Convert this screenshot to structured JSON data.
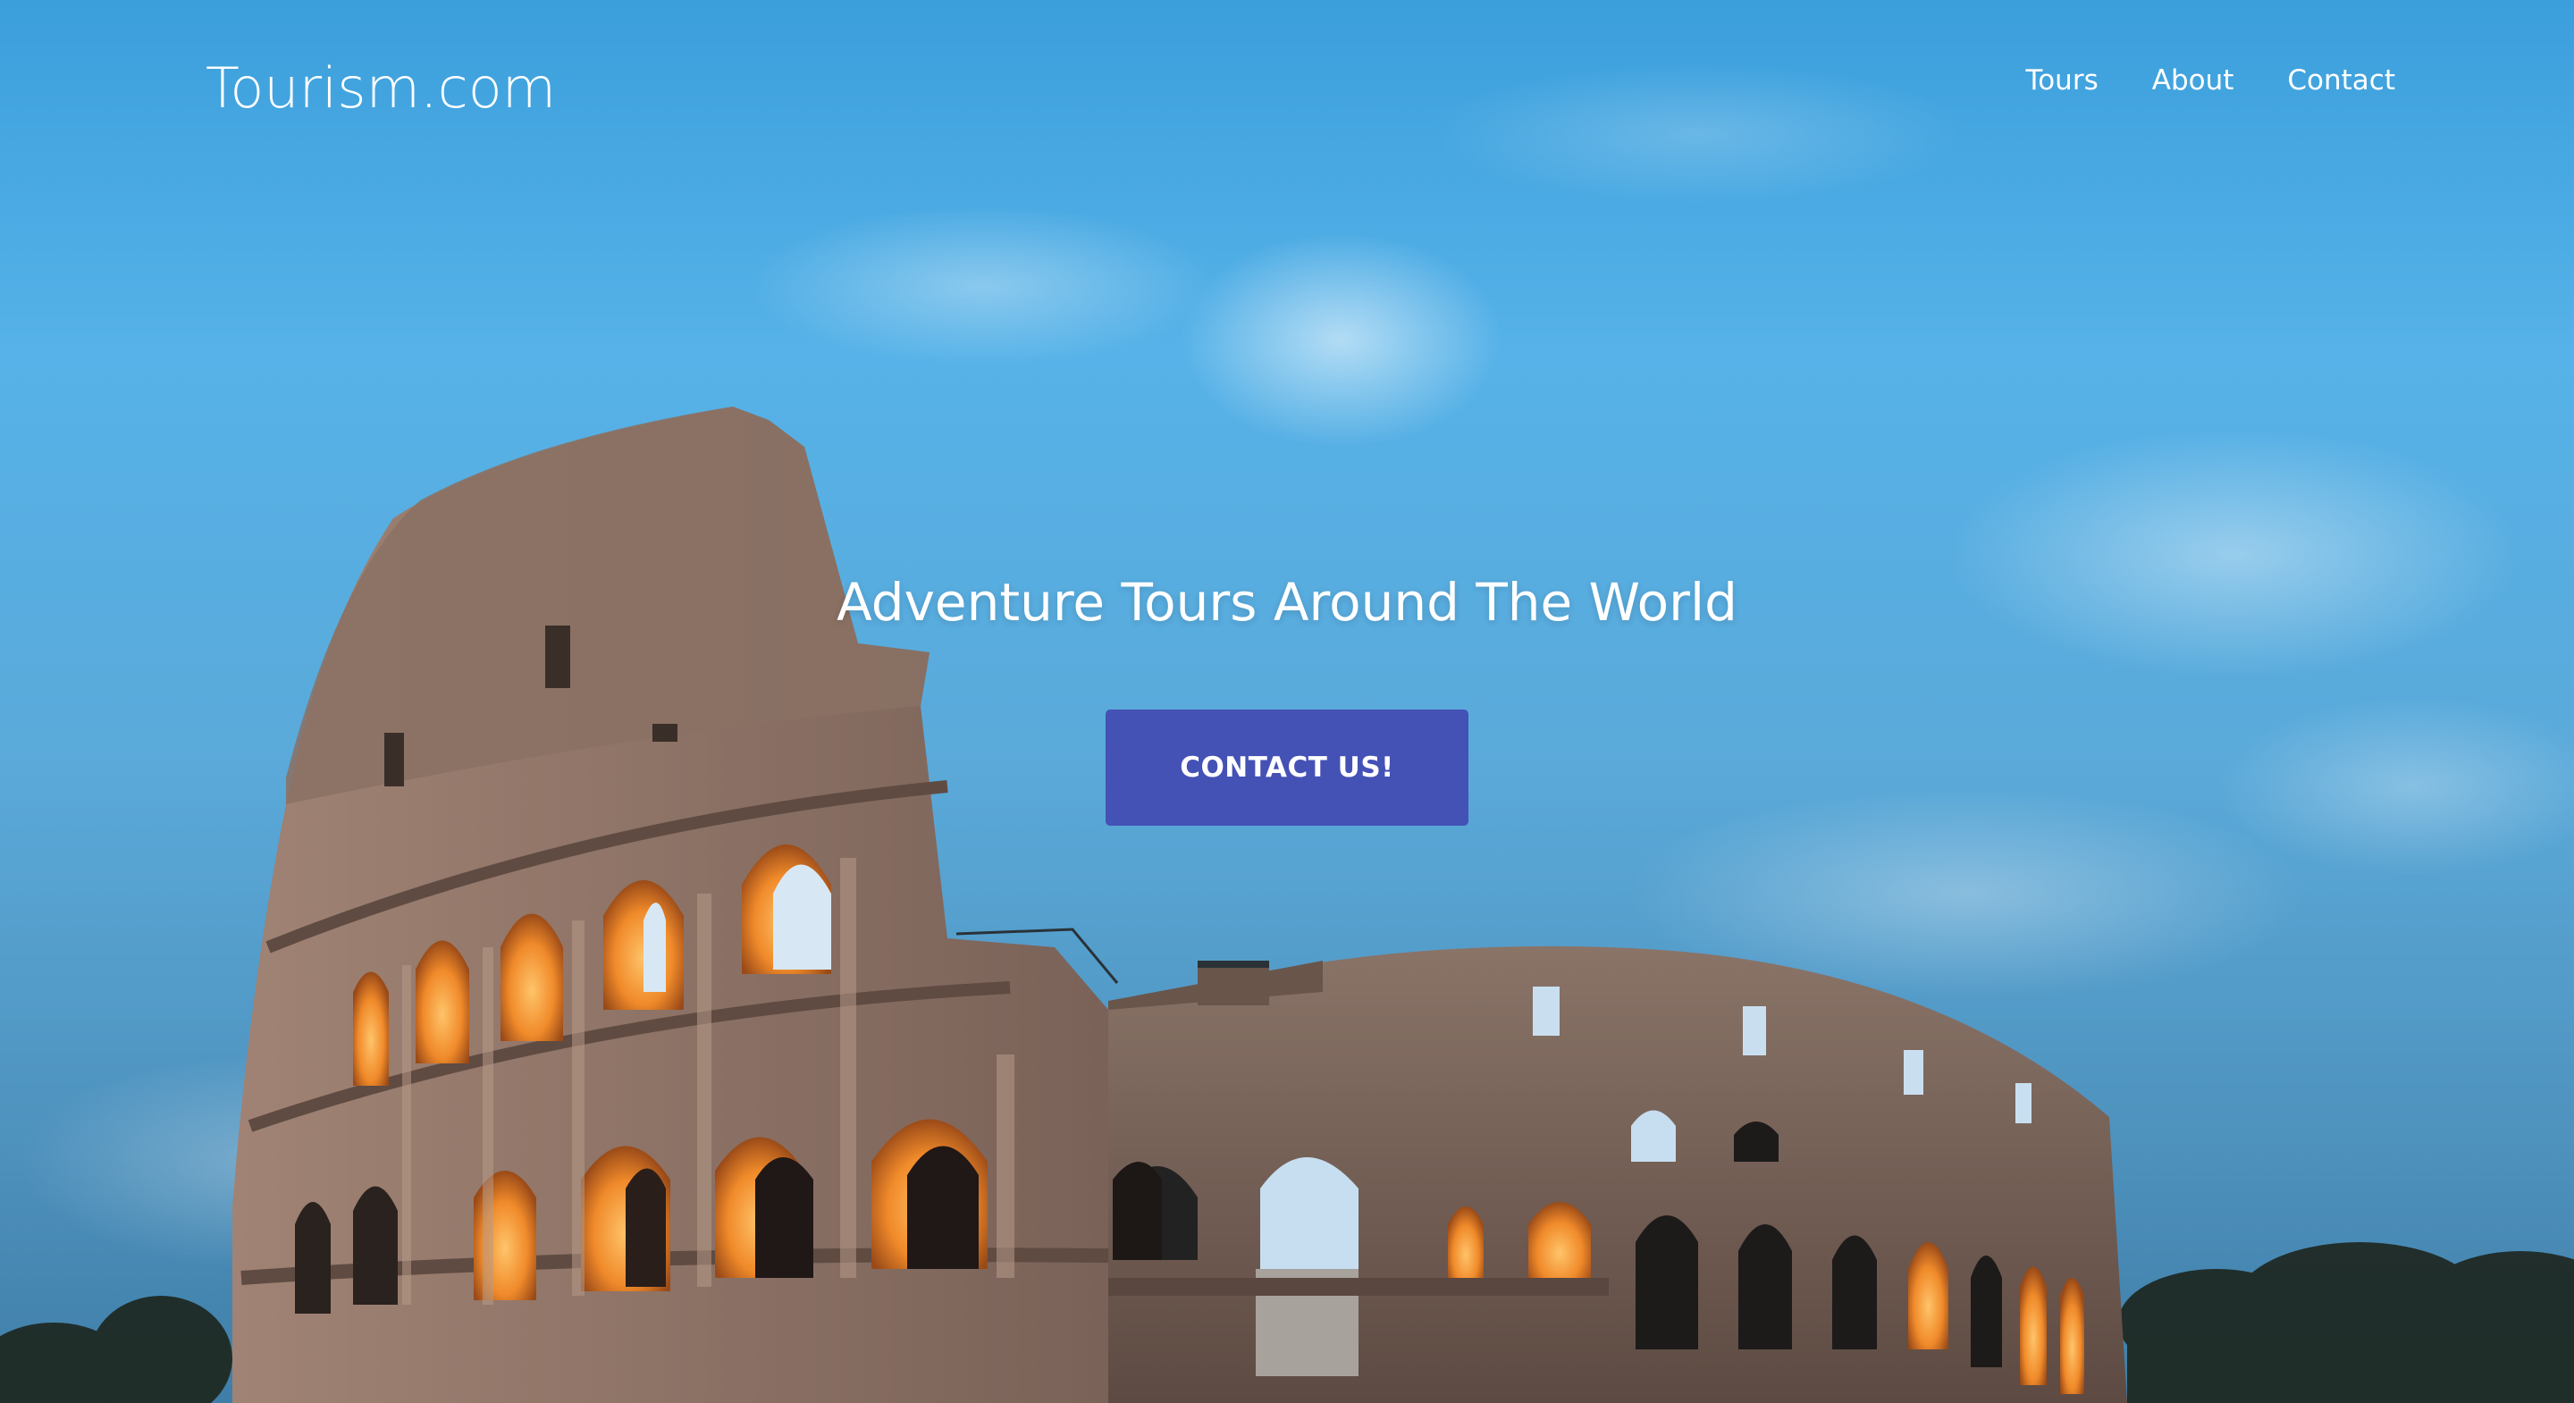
{
  "site": {
    "logo_text": "Tourism.com"
  },
  "nav": {
    "items": [
      {
        "label": "Tours"
      },
      {
        "label": "About"
      },
      {
        "label": "Contact"
      }
    ]
  },
  "hero": {
    "headline": "Adventure Tours Around The World",
    "cta_label": "CONTACT US!",
    "background_image": "colosseum-at-dusk"
  },
  "colors": {
    "sky": "#4aa8e0",
    "cta_background": "#4451b5",
    "text": "#ffffff",
    "stone": "#7a6258",
    "arch_glow": "#f08a2a"
  }
}
